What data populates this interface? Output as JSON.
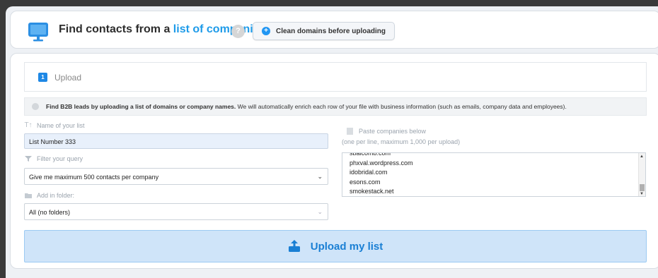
{
  "header": {
    "title_prefix": "Find contacts from a ",
    "title_highlight": "list of companies",
    "help_label": "?",
    "clean_button_label": "Clean domains before uploading",
    "plus_glyph": "+"
  },
  "step": {
    "number": "1",
    "label": "Upload"
  },
  "info": {
    "bold": "Find B2B leads by uploading a list of domains or company names.",
    "rest": " We will automatically enrich each row of your file with business information (such as emails, company data and employees)."
  },
  "form": {
    "name_label": "Name of your list",
    "name_value": "List Number 333",
    "filter_label": "Filter your query",
    "filter_value": "Give me maximum 500 contacts per company",
    "folder_label": "Add in folder:",
    "folder_value": "All (no folders)",
    "paste_label": "Paste companies below",
    "paste_hint": "(one per line, maximum 1,000 per upload)",
    "paste_lines": [
      "sbaicomb.com",
      "phxval.wordpress.com",
      "idobridal.com",
      "esons.com",
      "smokestack.net"
    ]
  },
  "upload_button_label": "Upload my list",
  "colors": {
    "accent": "#1e9be9",
    "button_bg": "#cfe4f9",
    "input_bg": "#e8f0fb"
  }
}
